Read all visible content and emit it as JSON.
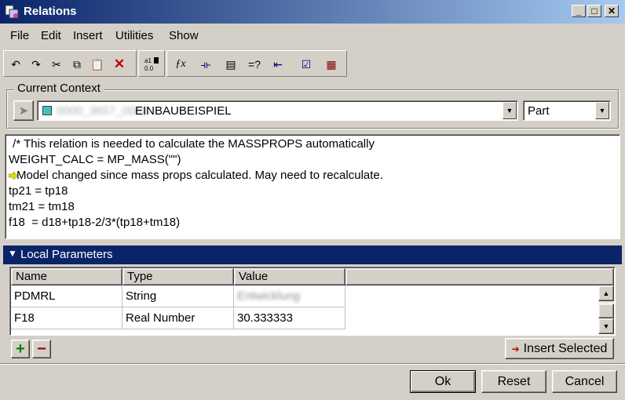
{
  "window": {
    "title": "Relations"
  },
  "menu": [
    "File",
    "Edit",
    "Insert",
    "Utilities",
    "Show"
  ],
  "toolbar_icons": [
    "undo-icon",
    "redo-icon",
    "cut-icon",
    "copy-icon",
    "paste-icon",
    "delete-icon",
    "sort-icon",
    "function-icon",
    "units-icon",
    "parameters-icon",
    "evaluate-icon",
    "pick-dimension-icon",
    "verify-icon",
    "notes-icon"
  ],
  "context": {
    "label": "Current Context",
    "model_name": "EINBAUBEISPIEL",
    "model_prefix_blurred": "0000_3657_0001",
    "type": "Part"
  },
  "relations": {
    "lines": [
      " /* This relation is needed to calculate the MASSPROPS automatically",
      "WEIGHT_CALC = MP_MASS(\"\")",
      "Model changed since mass props calculated. May need to recalculate.",
      "tp21 = tp18",
      "tm21 = tm18",
      "f18  = d18+tp18-2/3*(tp18+tm18)"
    ]
  },
  "local_parameters": {
    "title": "Local Parameters",
    "columns": [
      "Name",
      "Type",
      "Value"
    ],
    "rows": [
      {
        "name": "PDMRL",
        "type": "String",
        "value": "Entwicklung"
      },
      {
        "name": "F18",
        "type": "Real Number",
        "value": "30.333333"
      }
    ],
    "insert_label": "Insert Selected"
  },
  "buttons": {
    "ok": "Ok",
    "reset": "Reset",
    "cancel": "Cancel"
  },
  "colors": {
    "title_start": "#0a246a",
    "title_end": "#a6caf0",
    "panel": "#d4d0c8",
    "section_header": "#0a246a"
  }
}
